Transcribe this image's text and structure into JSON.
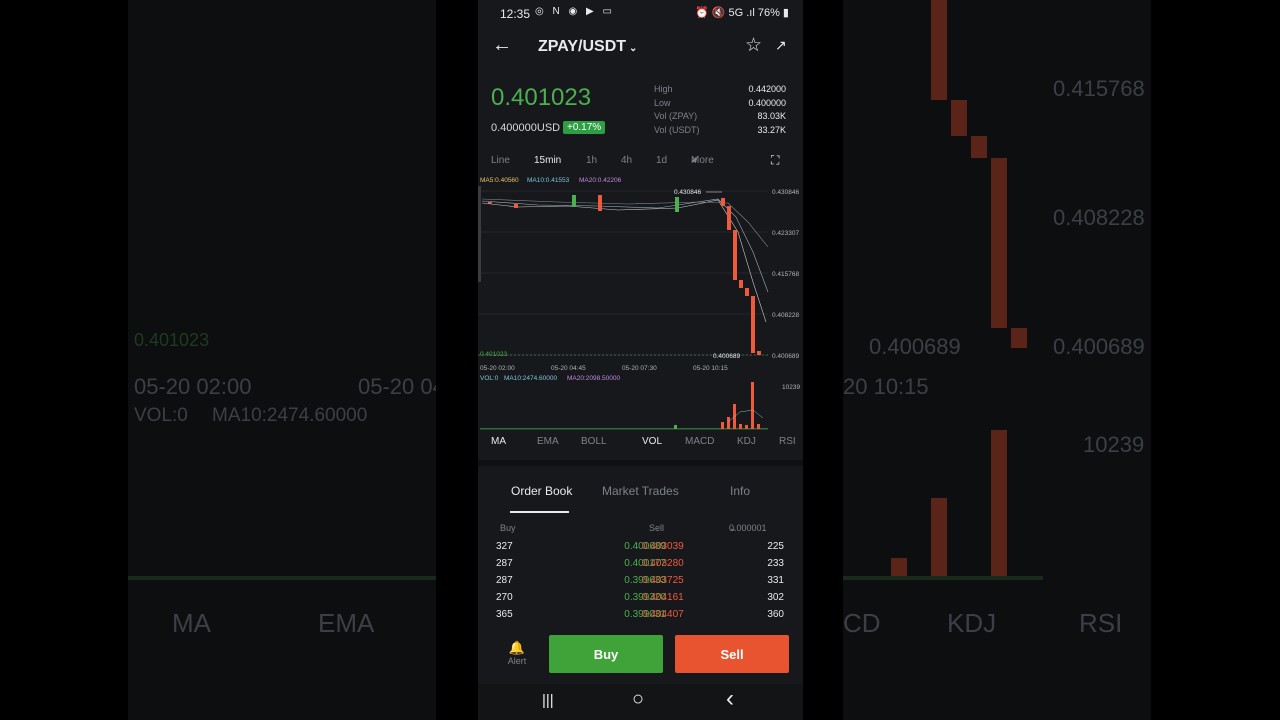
{
  "background": {
    "left": {
      "price": "0.401023",
      "time1": "05-20 02:00",
      "time2": "05-20 04",
      "vol": "VOL:0",
      "ma10": "MA10:2474.60000",
      "ma": "MA",
      "ema": "EMA"
    },
    "right": {
      "p1": "0.415768",
      "p2": "0.408228",
      "p3": "0.400689",
      "p3b": "0.400689",
      "time": "20 10:15",
      "vol": "10239",
      "cd": "CD",
      "kdj": "KDJ",
      "rsi": "RSI"
    }
  },
  "status_bar": {
    "time": "12:35",
    "left_icons": "◎ N ◉ ▶ ▭",
    "right": "⏰ 🔇 5G .ıl 76% ▮"
  },
  "header": {
    "back_icon": "arrow-left",
    "pair": "ZPAY/USDT",
    "chevron": "⌄",
    "star_icon": "star",
    "share_icon": "share"
  },
  "ticker": {
    "price": "0.401023",
    "usd": "0.400000USD",
    "change": "+0.17%",
    "stats": [
      {
        "k": "High",
        "v": "0.442000"
      },
      {
        "k": "Low",
        "v": "0.400000"
      },
      {
        "k": "Vol (ZPAY)",
        "v": "83.03K"
      },
      {
        "k": "Vol (USDT)",
        "v": "33.27K"
      }
    ]
  },
  "timeframes": {
    "line": "Line",
    "m15": "15min",
    "h1": "1h",
    "h4": "4h",
    "d1": "1d",
    "more": "More"
  },
  "chart": {
    "ma5": "MA5:0.40560",
    "ma10": "MA10:0.41553",
    "ma20": "MA20:0.42206",
    "high_label": "0.430846",
    "low_label": "0.400689",
    "current_label": "0.401023",
    "y_ticks": [
      "0.430846",
      "0.423307",
      "0.415768",
      "0.408228",
      "0.400689"
    ],
    "x_ticks": [
      "05-20 02:00",
      "05-20 04:45",
      "05-20 07:30",
      "05-20 10:15"
    ],
    "vol_label": "VOL:0",
    "vol_ma10": "MA10:2474.60000",
    "vol_ma20": "MA20:2098.50000",
    "vol_max": "10239"
  },
  "indicators": {
    "ma": "MA",
    "ema": "EMA",
    "boll": "BOLL",
    "vol": "VOL",
    "macd": "MACD",
    "kdj": "KDJ",
    "rsi": "RSI"
  },
  "orderbook": {
    "tabs": {
      "book": "Order Book",
      "trades": "Market Trades",
      "info": "Info"
    },
    "head": {
      "buy": "Buy",
      "sell": "Sell",
      "precision": "0.000001"
    },
    "rows": [
      {
        "bq": "327",
        "bp": "0.400689",
        "sp": "0.403039",
        "sq": "225"
      },
      {
        "bq": "287",
        "bp": "0.400177",
        "sp": "0.403280",
        "sq": "233"
      },
      {
        "bq": "287",
        "bp": "0.399633",
        "sp": "0.403725",
        "sq": "331"
      },
      {
        "bq": "270",
        "bp": "0.399320",
        "sp": "0.404161",
        "sq": "302"
      },
      {
        "bq": "365",
        "bp": "0.399031",
        "sp": "0.404407",
        "sq": "360"
      }
    ]
  },
  "actions": {
    "alert": "Alert",
    "buy": "Buy",
    "sell": "Sell"
  },
  "nav": {
    "recent": "|||",
    "home": "○",
    "back": "‹"
  },
  "colors": {
    "green": "#4caf50",
    "red": "#f05a3c",
    "bg": "#17181c"
  }
}
